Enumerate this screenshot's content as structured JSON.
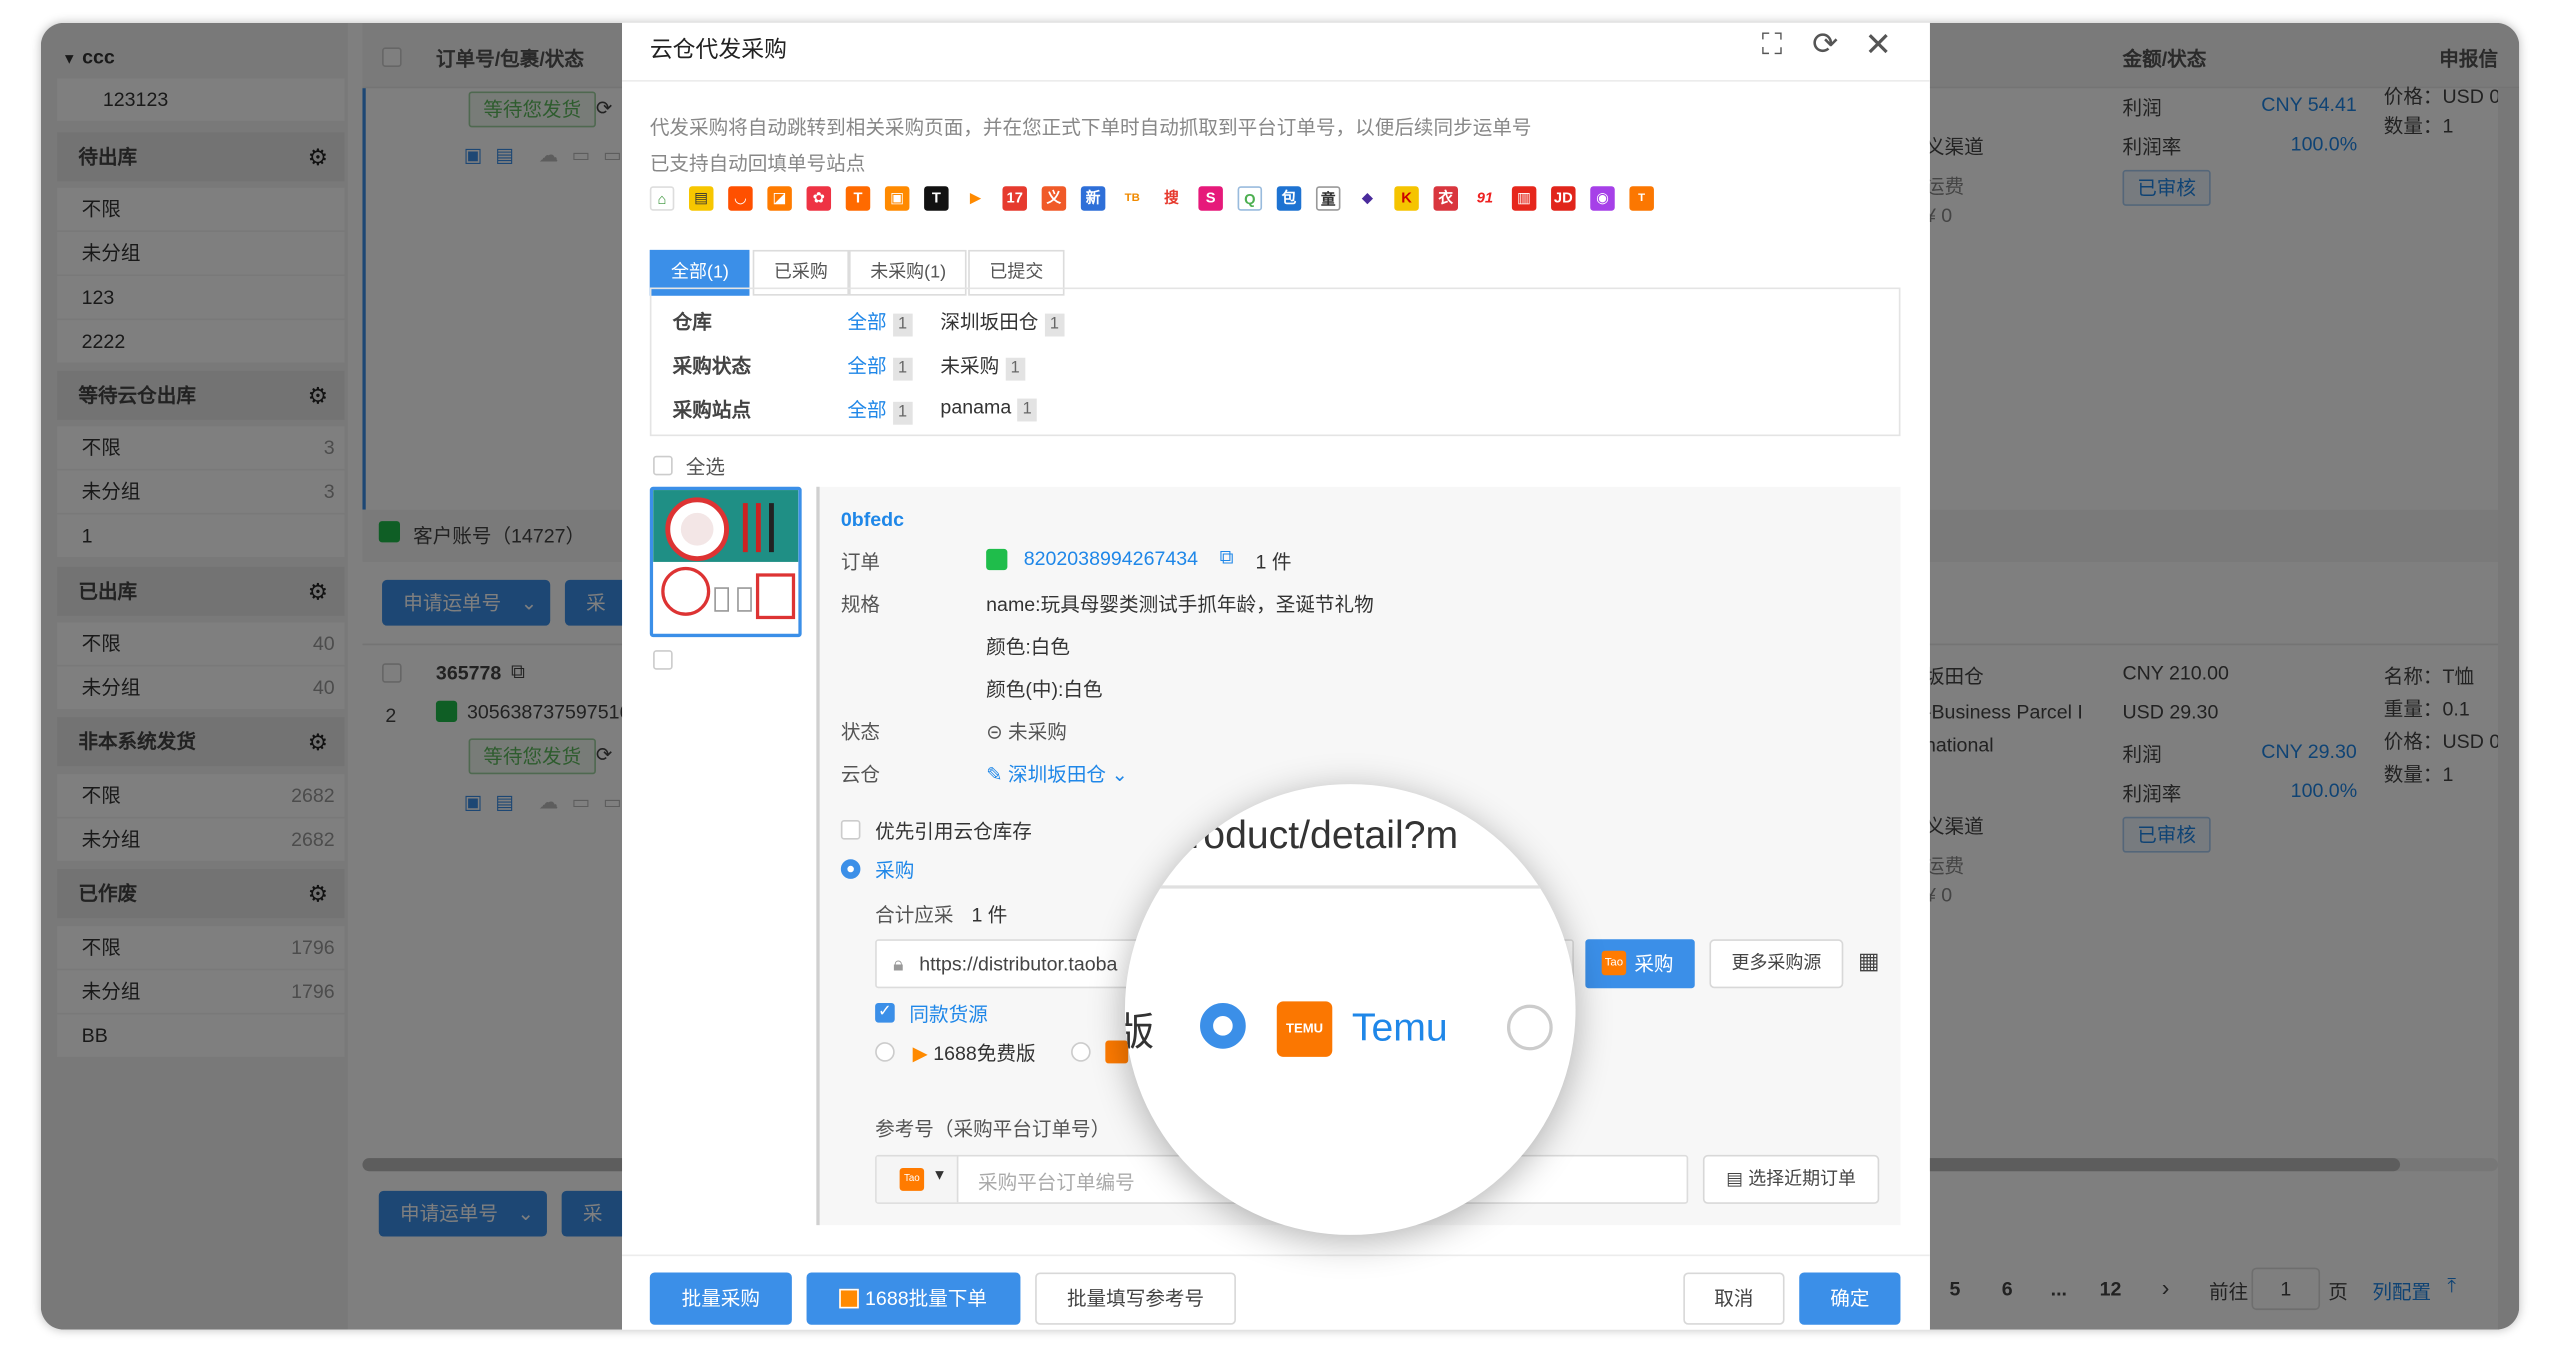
{
  "sidebar": {
    "top_group": "ccc",
    "top_item": "123123",
    "groups": [
      {
        "title": "待出库",
        "items": [
          {
            "label": "不限",
            "count": ""
          },
          {
            "label": "未分组",
            "count": ""
          },
          {
            "label": "123",
            "count": ""
          },
          {
            "label": "2222",
            "count": ""
          }
        ]
      },
      {
        "title": "等待云仓出库",
        "items": [
          {
            "label": "不限",
            "count": "3"
          },
          {
            "label": "未分组",
            "count": "3"
          },
          {
            "label": "1",
            "count": ""
          }
        ]
      },
      {
        "title": "已出库",
        "items": [
          {
            "label": "不限",
            "count": "40"
          },
          {
            "label": "未分组",
            "count": "40"
          }
        ]
      },
      {
        "title": "非本系统发货",
        "items": [
          {
            "label": "不限",
            "count": "2682"
          },
          {
            "label": "未分组",
            "count": "2682"
          }
        ]
      },
      {
        "title": "已作废",
        "items": [
          {
            "label": "不限",
            "count": "1796"
          },
          {
            "label": "未分组",
            "count": "1796"
          },
          {
            "label": "BB",
            "count": ""
          }
        ]
      }
    ]
  },
  "list": {
    "col_order": "订单号/包裹/状态",
    "col_amount": "金额/状态",
    "col_declare": "申报信",
    "order1": {
      "status_tag": "等待您发货",
      "profit_label": "利润",
      "profit_value": "CNY 54.41",
      "margin_label": "利润率",
      "margin_value": "100.0%",
      "audited": "已审核",
      "price_partial": "价格：USD 0",
      "qty": "数量：1",
      "channel_partial": "义渠道",
      "freight_partial": "运费",
      "freight_val": "¥ 0"
    },
    "customer_account": "客户账号（14727）",
    "apply_waybill": "申请运单号",
    "purchase_partial": "采购",
    "order2": {
      "order_no": "365778",
      "row_index": "2",
      "platform_order_partial": "305638737597516",
      "status_tag": "等待您发货",
      "warehouse_partial": "坂田仓",
      "service_partial": "-Business Parcel I",
      "service_partial2": "national",
      "channel_partial": "义渠道",
      "freight_partial": "运费",
      "freight_val": "¥ 0",
      "amount1": "CNY 210.00",
      "amount2": "USD 29.30",
      "profit_label": "利润",
      "profit_value": "CNY 29.30",
      "margin_label": "利润率",
      "margin_value": "100.0%",
      "audited": "已审核",
      "decl_name": "名称：T恤",
      "decl_weight": "重量：0.1",
      "decl_price": "价格：USD 0",
      "decl_qty": "数量：1"
    },
    "pagination": {
      "pages": [
        "5",
        "6",
        "...",
        "12"
      ],
      "goto_label": "前往",
      "goto_value": "1",
      "page_unit": "页",
      "col_config": "列配置"
    }
  },
  "modal": {
    "title": "云仓代发采购",
    "desc": "代发采购将自动跳转到相关采购页面，并在您正式下单时自动抓取到平台订单号，以便后续同步运单号",
    "support": "已支持自动回填单号站点",
    "tabs": [
      "全部(1)",
      "已采购",
      "未采购(1)",
      "已提交"
    ],
    "filters": [
      {
        "label": "仓库",
        "all": "全部",
        "all_count": "1",
        "opt": "深圳坂田仓",
        "opt_count": "1"
      },
      {
        "label": "采购状态",
        "all": "全部",
        "all_count": "1",
        "opt": "未采购",
        "opt_count": "1"
      },
      {
        "label": "采购站点",
        "all": "全部",
        "all_count": "1",
        "opt": "panama",
        "opt_count": "1"
      }
    ],
    "select_all": "全选",
    "item": {
      "code": "0bfedc",
      "order_label": "订单",
      "order_no": "8202038994267434",
      "order_qty": "1 件",
      "spec_label": "规格",
      "spec1": "name:玩具母婴类测试手抓年龄，圣诞节礼物",
      "spec2": "颜色:白色",
      "spec3": "颜色(中):白色",
      "status_label": "状态",
      "status_value": "未采购",
      "wh_label": "云仓",
      "wh_value": "深圳坂田仓"
    },
    "prefer_stock": "优先引用云仓库存",
    "purchase_radio": "采购",
    "total_label": "合计应采",
    "total_value": "1 件",
    "url_value": "https://distributor.taoba",
    "purchase_btn": "采购",
    "more_sources": "更多采购源",
    "same_source": "同款货源",
    "src_1688": "1688免费版",
    "ref_label": "参考号（采购平台订单号）",
    "ref_placeholder": "采购平台订单编号",
    "select_recent": "选择近期订单",
    "footer": {
      "batch_purchase": "批量采购",
      "batch_1688": "1688批量下单",
      "batch_ref": "批量填写参考号",
      "cancel": "取消",
      "confirm": "确定"
    },
    "magnifier": {
      "url_fragment": "roduct/detail?m",
      "left_char": "版",
      "platform": "Temu",
      "icon_text": "TEMU"
    }
  },
  "colors": {
    "primary": "#3b8fe8",
    "success": "#5cb85c",
    "temu": "#fb7701"
  }
}
